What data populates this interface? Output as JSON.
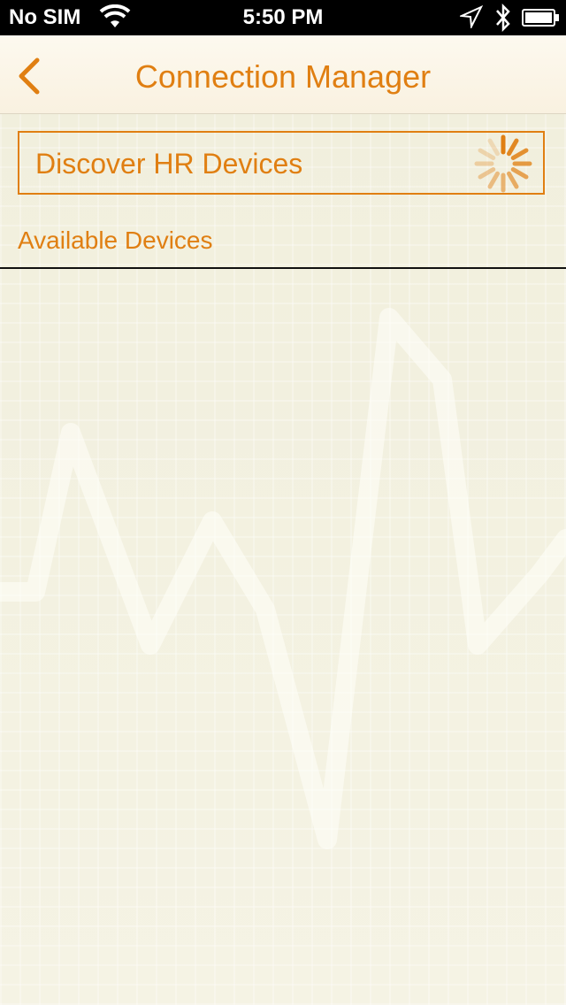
{
  "status_bar": {
    "carrier": "No SIM",
    "time": "5:50 PM",
    "icons": [
      "wifi-icon",
      "location-arrow-icon",
      "bluetooth-icon",
      "battery-icon"
    ]
  },
  "nav": {
    "title": "Connection Manager",
    "back_icon": "chevron-left-icon"
  },
  "discover": {
    "label": "Discover HR Devices",
    "spinner_icon": "activity-spinner-icon"
  },
  "section": {
    "available_devices_label": "Available Devices"
  },
  "device_list": [],
  "colors": {
    "accent": "#e07f12",
    "background": "#f4f2e2",
    "status_bar": "#000000"
  }
}
